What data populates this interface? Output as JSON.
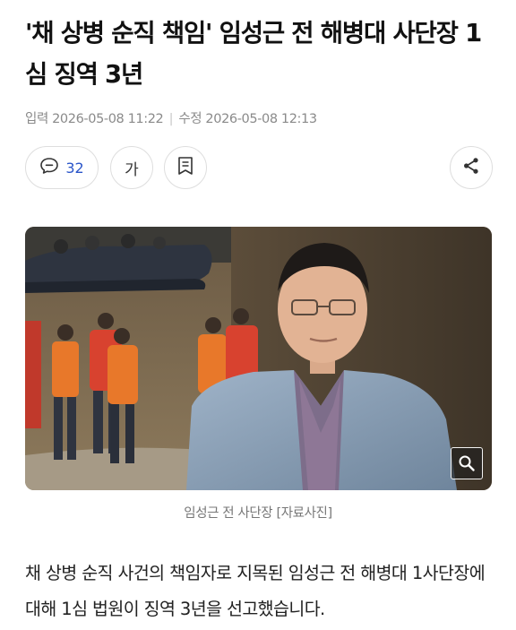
{
  "article": {
    "headline": "'채 상병 순직 책임' 임성근 전 해병대 사단장 1심 징역 3년",
    "meta": {
      "input_label": "입력",
      "input_time": "2026-05-08 11:22",
      "separator": "|",
      "edit_label": "수정",
      "edit_time": "2026-05-08 12:13"
    },
    "toolbar": {
      "comment_count": "32",
      "font_size_label": "가",
      "comment_icon": "comment-bubble-icon",
      "bookmark_icon": "bookmark-list-icon",
      "share_icon": "share-icon",
      "zoom_icon": "magnifier-icon"
    },
    "image_caption": "임성근 전 사단장 [자료사진]",
    "body": "채 상병 순직 사건의 책임자로 지목된 임성근 전 해병대 1사단장에 대해 1심 법원이 징역 3년을 선고했습니다."
  },
  "colors": {
    "comment_count": "#2a55c9",
    "meta_text": "#8a8a8a",
    "caption_text": "#777777"
  }
}
